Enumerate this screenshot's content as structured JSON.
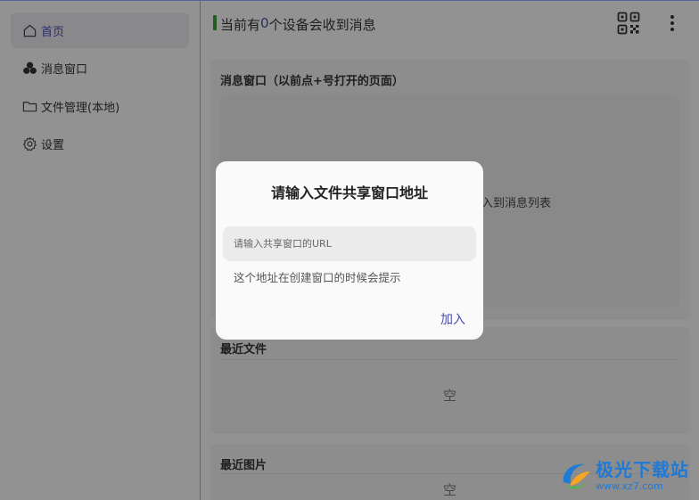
{
  "sidebar": {
    "items": [
      {
        "label": "首页",
        "icon": "home-icon",
        "active": true
      },
      {
        "label": "消息窗口",
        "icon": "circles-icon",
        "active": false
      },
      {
        "label": "文件管理(本地)",
        "icon": "folder-icon",
        "active": false
      },
      {
        "label": "设置",
        "icon": "gear-icon",
        "active": false
      }
    ]
  },
  "header": {
    "status_prefix": "当前有",
    "device_count": "0",
    "status_suffix": "个设备会收到消息",
    "qr_icon": "qr-code-icon",
    "more_icon": "more-vertical-icon"
  },
  "panels": {
    "message_window": {
      "title": "消息窗口（以前点+号打开的页面）",
      "hint_partial": "进入到消息列表"
    },
    "recent_files": {
      "title": "最近文件",
      "empty": "空"
    },
    "recent_images": {
      "title": "最近图片",
      "empty": "空"
    }
  },
  "dialog": {
    "title": "请输入文件共享窗口地址",
    "input_placeholder": "请输入共享窗口的URL",
    "input_value": "",
    "hint": "这个地址在创建窗口的时候会提示",
    "confirm_label": "加入"
  },
  "watermark": {
    "name": "极光下载站",
    "url": "www.xz7.com"
  },
  "colors": {
    "accent": "#4a4fb0",
    "status_green": "#3a9a3a",
    "watermark_blue": "#1f7ad6"
  }
}
